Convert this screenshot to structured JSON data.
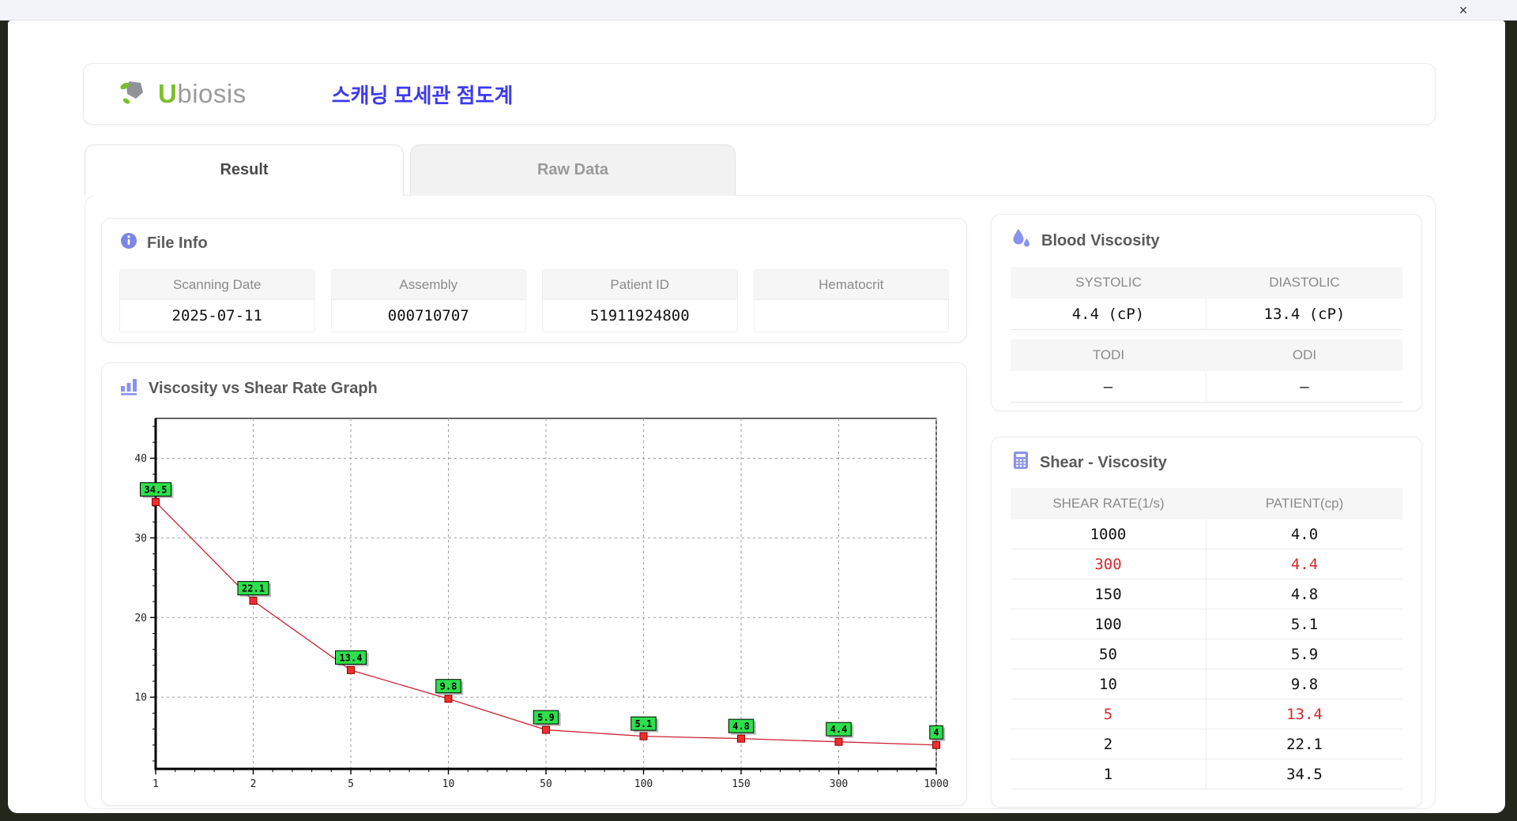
{
  "window": {
    "close_glyph": "×"
  },
  "brand": {
    "logo_u": "U",
    "logo_rest": "biosis",
    "app_title": "스캐닝 모세관 점도계"
  },
  "tabs": {
    "result": "Result",
    "raw_data": "Raw Data"
  },
  "file_info": {
    "title": "File Info",
    "fields": [
      {
        "label": "Scanning Date",
        "value": "2025-07-11"
      },
      {
        "label": "Assembly",
        "value": "000710707"
      },
      {
        "label": "Patient ID",
        "value": "51911924800"
      },
      {
        "label": "Hematocrit",
        "value": ""
      }
    ]
  },
  "blood_viscosity": {
    "title": "Blood Viscosity",
    "systolic_label": "SYSTOLIC",
    "diastolic_label": "DIASTOLIC",
    "systolic_value": "4.4 (cP)",
    "diastolic_value": "13.4 (cP)",
    "todi_label": "TODI",
    "odi_label": "ODI",
    "todi_value": "–",
    "odi_value": "–"
  },
  "shear_viscosity": {
    "title": "Shear - Viscosity",
    "columns": [
      "SHEAR RATE(1/s)",
      "PATIENT(cp)"
    ],
    "rows": [
      {
        "shear": "1000",
        "patient": "4.0",
        "highlight": false
      },
      {
        "shear": "300",
        "patient": "4.4",
        "highlight": true
      },
      {
        "shear": "150",
        "patient": "4.8",
        "highlight": false
      },
      {
        "shear": "100",
        "patient": "5.1",
        "highlight": false
      },
      {
        "shear": "50",
        "patient": "5.9",
        "highlight": false
      },
      {
        "shear": "10",
        "patient": "9.8",
        "highlight": false
      },
      {
        "shear": "5",
        "patient": "13.4",
        "highlight": true
      },
      {
        "shear": "2",
        "patient": "22.1",
        "highlight": false
      },
      {
        "shear": "1",
        "patient": "34.5",
        "highlight": false
      }
    ]
  },
  "graph": {
    "title": "Viscosity vs Shear Rate Graph"
  },
  "chart_data": {
    "type": "line",
    "title": "Viscosity vs Shear Rate Graph",
    "x_scale": "categorical",
    "categories": [
      1,
      2,
      5,
      10,
      50,
      100,
      150,
      300,
      1000
    ],
    "series": [
      {
        "name": "PATIENT(cp)",
        "values": [
          34.5,
          22.1,
          13.4,
          9.8,
          5.9,
          5.1,
          4.8,
          4.4,
          4.0
        ]
      }
    ],
    "point_labels": [
      "34.5",
      "22.1",
      "13.4",
      "9.8",
      "5.9",
      "5.1",
      "4.8",
      "4.4",
      "4"
    ],
    "xlabel": "",
    "ylabel": "",
    "yticks": [
      10,
      20,
      30,
      40
    ],
    "ylim": [
      1,
      45
    ],
    "grid": true,
    "legend": false,
    "line_color": "#cc2233",
    "marker_color": "#f02e2e",
    "marker_edge": "#8b0000",
    "label_bg": "#2de04c",
    "label_border": "#000000"
  },
  "colors": {
    "accent_blue": "#3d3af0",
    "icon_purple": "#8a92ea",
    "logo_green": "#7cbf2e",
    "highlight_red": "#d42a2a"
  }
}
